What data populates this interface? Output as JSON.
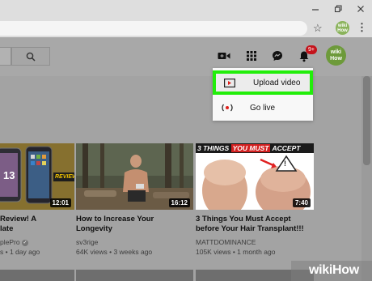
{
  "browser": {
    "window_controls": [
      "minimize-icon",
      "restore-icon",
      "close-icon"
    ],
    "star_icon": "star-icon",
    "profile_avatar_text": "wiki How",
    "menu_icon": "kebab-icon"
  },
  "header": {
    "search_icon": "search-icon",
    "icons": [
      "create-video-icon",
      "apps-grid-icon",
      "messages-icon",
      "notifications-bell-icon"
    ],
    "notification_badge": "9+",
    "avatar_text_1": "wiki",
    "avatar_text_2": "How"
  },
  "menu": {
    "items": [
      {
        "label": "Upload video",
        "icon": "upload-video-icon",
        "highlighted": true,
        "highlight_color": "#22ee0a"
      },
      {
        "label": "Go live",
        "icon": "go-live-icon"
      }
    ]
  },
  "videos": [
    {
      "title_line1": "Review! A",
      "title_line2": "late",
      "channel": "plePro",
      "verified": true,
      "meta": "s • 1 day ago",
      "duration": "12:01",
      "thumb_text": "REVIEW",
      "thumb_number": "13"
    },
    {
      "title_line1": "How to Increase Your",
      "title_line2": "Longevity",
      "channel": "sv3rige",
      "verified": false,
      "meta": "64K views • 3 weeks ago",
      "duration": "16:12"
    },
    {
      "title_line1": "3 Things You Must Accept",
      "title_line2": "before Your Hair Transplant!!!",
      "channel": "MATTDOMINANCE",
      "verified": false,
      "meta": "105K views • 1 month ago",
      "duration": "7:40",
      "thumb_text_white": "3 THINGS",
      "thumb_text_red": "YOU MUST",
      "thumb_text_white2": "ACCEPT"
    }
  ],
  "watermark": {
    "wiki": "wiki",
    "how": "How"
  }
}
